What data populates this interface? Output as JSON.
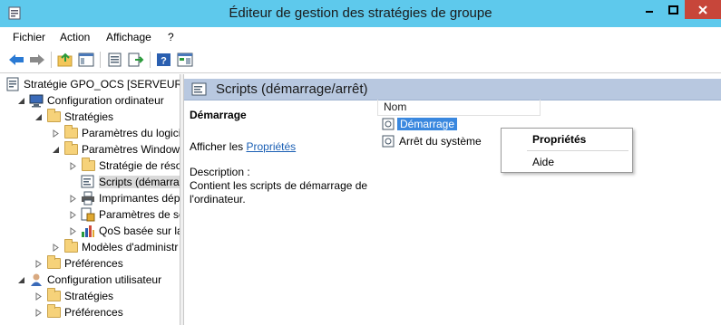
{
  "window": {
    "title": "Éditeur de gestion des stratégies de groupe",
    "controls": {
      "min": "minimize",
      "max": "maximize",
      "close": "close"
    }
  },
  "menu": [
    "Fichier",
    "Action",
    "Affichage",
    "?"
  ],
  "toolbar": {
    "icons": [
      "back-icon",
      "forward-icon",
      "up-folder-icon",
      "show-tree-icon",
      "properties-icon",
      "export-icon",
      "help-icon",
      "console-icon"
    ]
  },
  "tree": [
    {
      "label": "Stratégie GPO_OCS [SERVEUR.C",
      "icon": "gpo-icon",
      "indent": 0,
      "expander": ""
    },
    {
      "label": "Configuration ordinateur",
      "icon": "computer-icon",
      "indent": 1,
      "expander": "open"
    },
    {
      "label": "Stratégies",
      "icon": "folder-icon",
      "indent": 2,
      "expander": "open"
    },
    {
      "label": "Paramètres du logici",
      "icon": "folder-icon",
      "indent": 3,
      "expander": "closed"
    },
    {
      "label": "Paramètres Windows",
      "icon": "folder-icon",
      "indent": 3,
      "expander": "open"
    },
    {
      "label": "Stratégie de résol",
      "icon": "folder-icon",
      "indent": 4,
      "expander": "closed"
    },
    {
      "label": "Scripts (démarrag",
      "icon": "script-icon",
      "indent": 4,
      "expander": "",
      "selected": true
    },
    {
      "label": "Imprimantes dép",
      "icon": "printer-icon",
      "indent": 4,
      "expander": "closed"
    },
    {
      "label": "Paramètres de sé",
      "icon": "security-icon",
      "indent": 4,
      "expander": "closed"
    },
    {
      "label": "QoS basée sur la",
      "icon": "chart-icon",
      "indent": 4,
      "expander": "closed"
    },
    {
      "label": "Modèles d'administr",
      "icon": "folder-icon",
      "indent": 3,
      "expander": "closed"
    },
    {
      "label": "Préférences",
      "icon": "folder-icon",
      "indent": 2,
      "expander": "closed"
    },
    {
      "label": "Configuration utilisateur",
      "icon": "user-icon",
      "indent": 1,
      "expander": "open"
    },
    {
      "label": "Stratégies",
      "icon": "folder-icon",
      "indent": 2,
      "expander": "closed"
    },
    {
      "label": "Préférences",
      "icon": "folder-icon",
      "indent": 2,
      "expander": "closed"
    }
  ],
  "panel": {
    "title": "Scripts (démarrage/arrêt)",
    "section_heading": "Démarrage",
    "show_text": "Afficher les ",
    "show_link": "Propriétés",
    "description_label": "Description :",
    "description_text": "Contient les scripts de démarrage de l'ordinateur."
  },
  "list": {
    "column": "Nom",
    "items": [
      {
        "label": "Démarrage",
        "selected": true
      },
      {
        "label": "Arrêt du système",
        "selected": false
      }
    ]
  },
  "context_menu": {
    "items": [
      {
        "label": "Propriétés",
        "bold": true
      },
      {
        "label": "Aide",
        "bold": false
      }
    ]
  },
  "colors": {
    "titlebar": "#5ec9ec",
    "close_button": "#c7463a",
    "panel_header": "#b8c8e0",
    "selection": "#3a88df",
    "link": "#1a5fb4"
  }
}
